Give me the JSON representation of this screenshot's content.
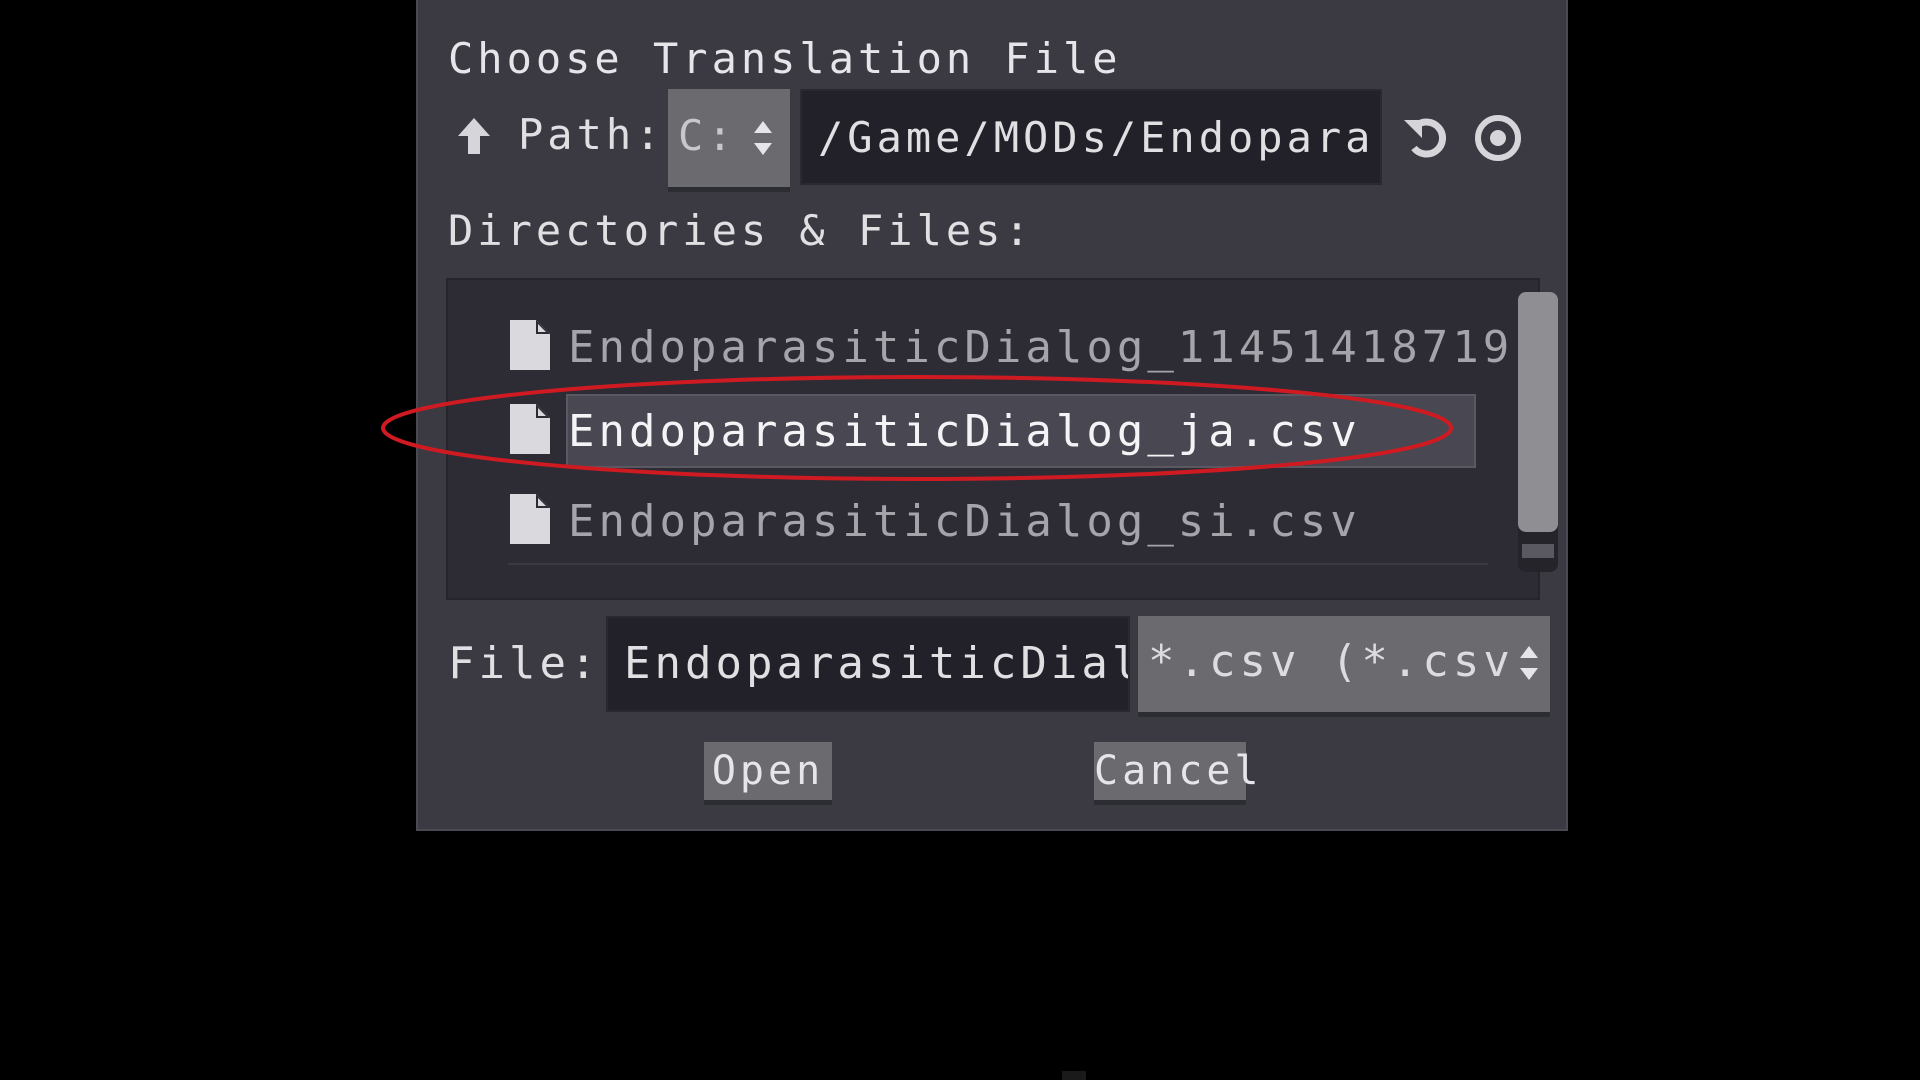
{
  "dialog": {
    "title": "Choose Translation File",
    "path_label": "Path:",
    "drive": "C:",
    "path_value": "/Game/MODs/Endopara",
    "dir_label": "Directories & Files:",
    "files": [
      {
        "name": "EndoparasiticDialog_11451418719",
        "selected": false
      },
      {
        "name": "EndoparasiticDialog_ja.csv",
        "selected": true
      },
      {
        "name": "EndoparasiticDialog_si.csv",
        "selected": false
      }
    ],
    "file_label": "File:",
    "file_value": "EndoparasiticDial",
    "filter_value": "*.csv (*.csv",
    "open_label": "Open",
    "cancel_label": "Cancel"
  },
  "icons": {
    "up": "arrow-up-icon",
    "refresh": "refresh-icon",
    "hidden_toggle": "eye-icon",
    "file": "file-icon"
  },
  "colors": {
    "dialog_bg": "#3b3a43",
    "field_bg": "#22212a",
    "button_bg": "#6b6a6f",
    "selection": "#494852",
    "annotation": "#d01a22"
  }
}
